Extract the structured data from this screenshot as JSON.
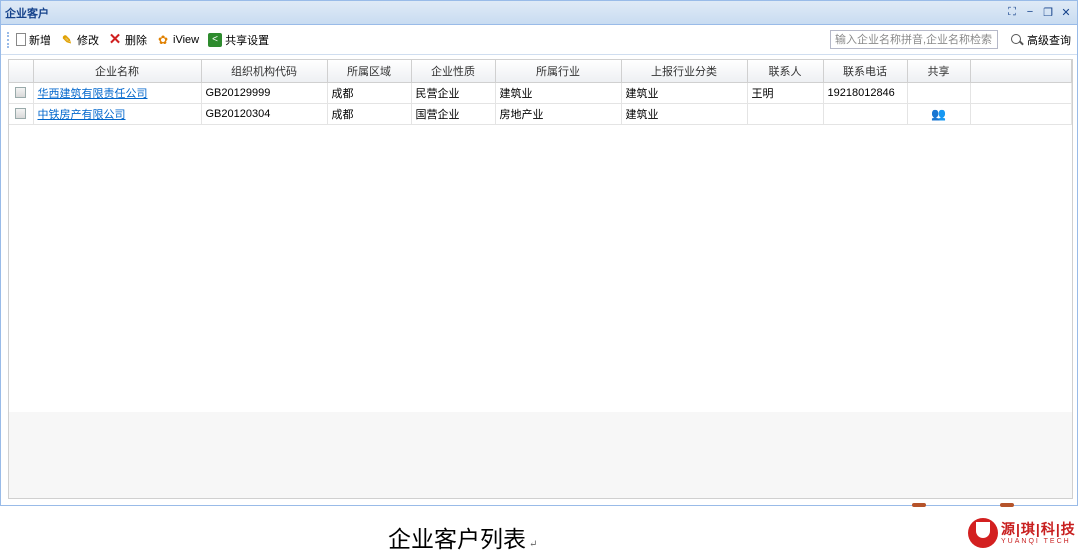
{
  "window": {
    "title": "企业客户",
    "controls": [
      "⛶",
      "−",
      "❐",
      "✕"
    ]
  },
  "toolbar": {
    "new_label": "新增",
    "edit_label": "修改",
    "delete_label": "删除",
    "iview_label": "iView",
    "share_settings_label": "共享设置",
    "search_placeholder": "输入企业名称拼音,企业名称检索",
    "advanced_search_label": "高级查询"
  },
  "table": {
    "columns": [
      "企业名称",
      "组织机构代码",
      "所属区域",
      "企业性质",
      "所属行业",
      "上报行业分类",
      "联系人",
      "联系电话",
      "共享"
    ],
    "rows": [
      {
        "name": "华西建筑有限责任公司",
        "org_code": "GB20129999",
        "region": "成都",
        "nature": "民营企业",
        "industry": "建筑业",
        "report_category": "建筑业",
        "contact": "王明",
        "phone": "19218012846",
        "shared": false
      },
      {
        "name": "中铁房产有限公司",
        "org_code": "GB20120304",
        "region": "成都",
        "nature": "国营企业",
        "industry": "房地产业",
        "report_category": "建筑业",
        "contact": "",
        "phone": "",
        "shared": true
      }
    ]
  },
  "caption": "企业客户列表",
  "logo": {
    "cn": "源|琪|科|技",
    "en": "YUANQI TECH"
  },
  "colors": {
    "title_text": "#15428b",
    "link": "#0066cc",
    "logo_red": "#c81e1e"
  }
}
